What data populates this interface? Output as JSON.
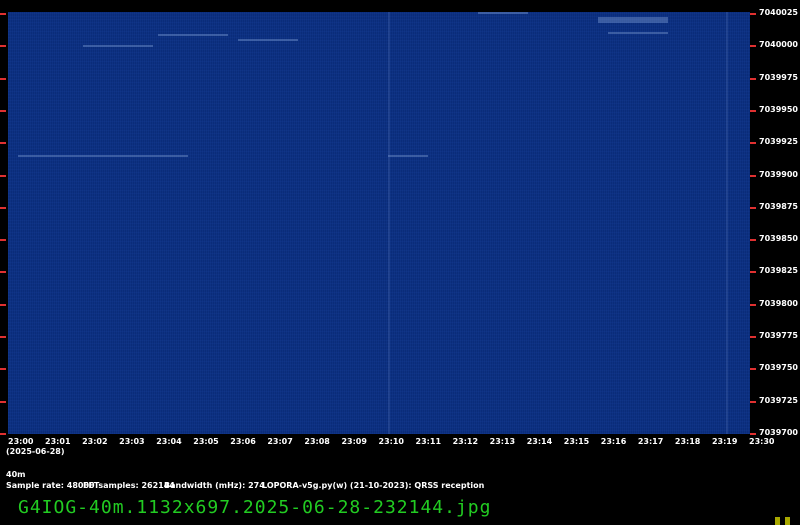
{
  "y_axis": {
    "labels": [
      "7040025",
      "7040000",
      "7039975",
      "7039950",
      "7039925",
      "7039900",
      "7039875",
      "7039850",
      "7039825",
      "7039800",
      "7039775",
      "7039750",
      "7039725",
      "7039700"
    ]
  },
  "x_axis": {
    "labels": [
      "23:00",
      "23:01",
      "23:02",
      "23:03",
      "23:04",
      "23:05",
      "23:06",
      "23:07",
      "23:08",
      "23:09",
      "23:10",
      "23:11",
      "23:12",
      "23:13",
      "23:14",
      "23:15",
      "23:16",
      "23:17",
      "23:18",
      "23:19",
      "23:30"
    ],
    "date": "(2025-06-28)"
  },
  "info": {
    "band": "40m",
    "sample_rate": "Sample rate: 48000",
    "fft_samples": "FFTsamples: 262144",
    "bandwidth": "Bandwidth (mHz): 274",
    "software": "LOPORA-v5g.py(w) (21-10-2023): QRSS reception"
  },
  "filename": "G4IOG-40m.1132x697.2025-06-28-232144.jpg",
  "colors": {
    "background": "#000000",
    "plot": "#0a2c7a",
    "tick": "#e03030",
    "filename": "#22cc22"
  }
}
